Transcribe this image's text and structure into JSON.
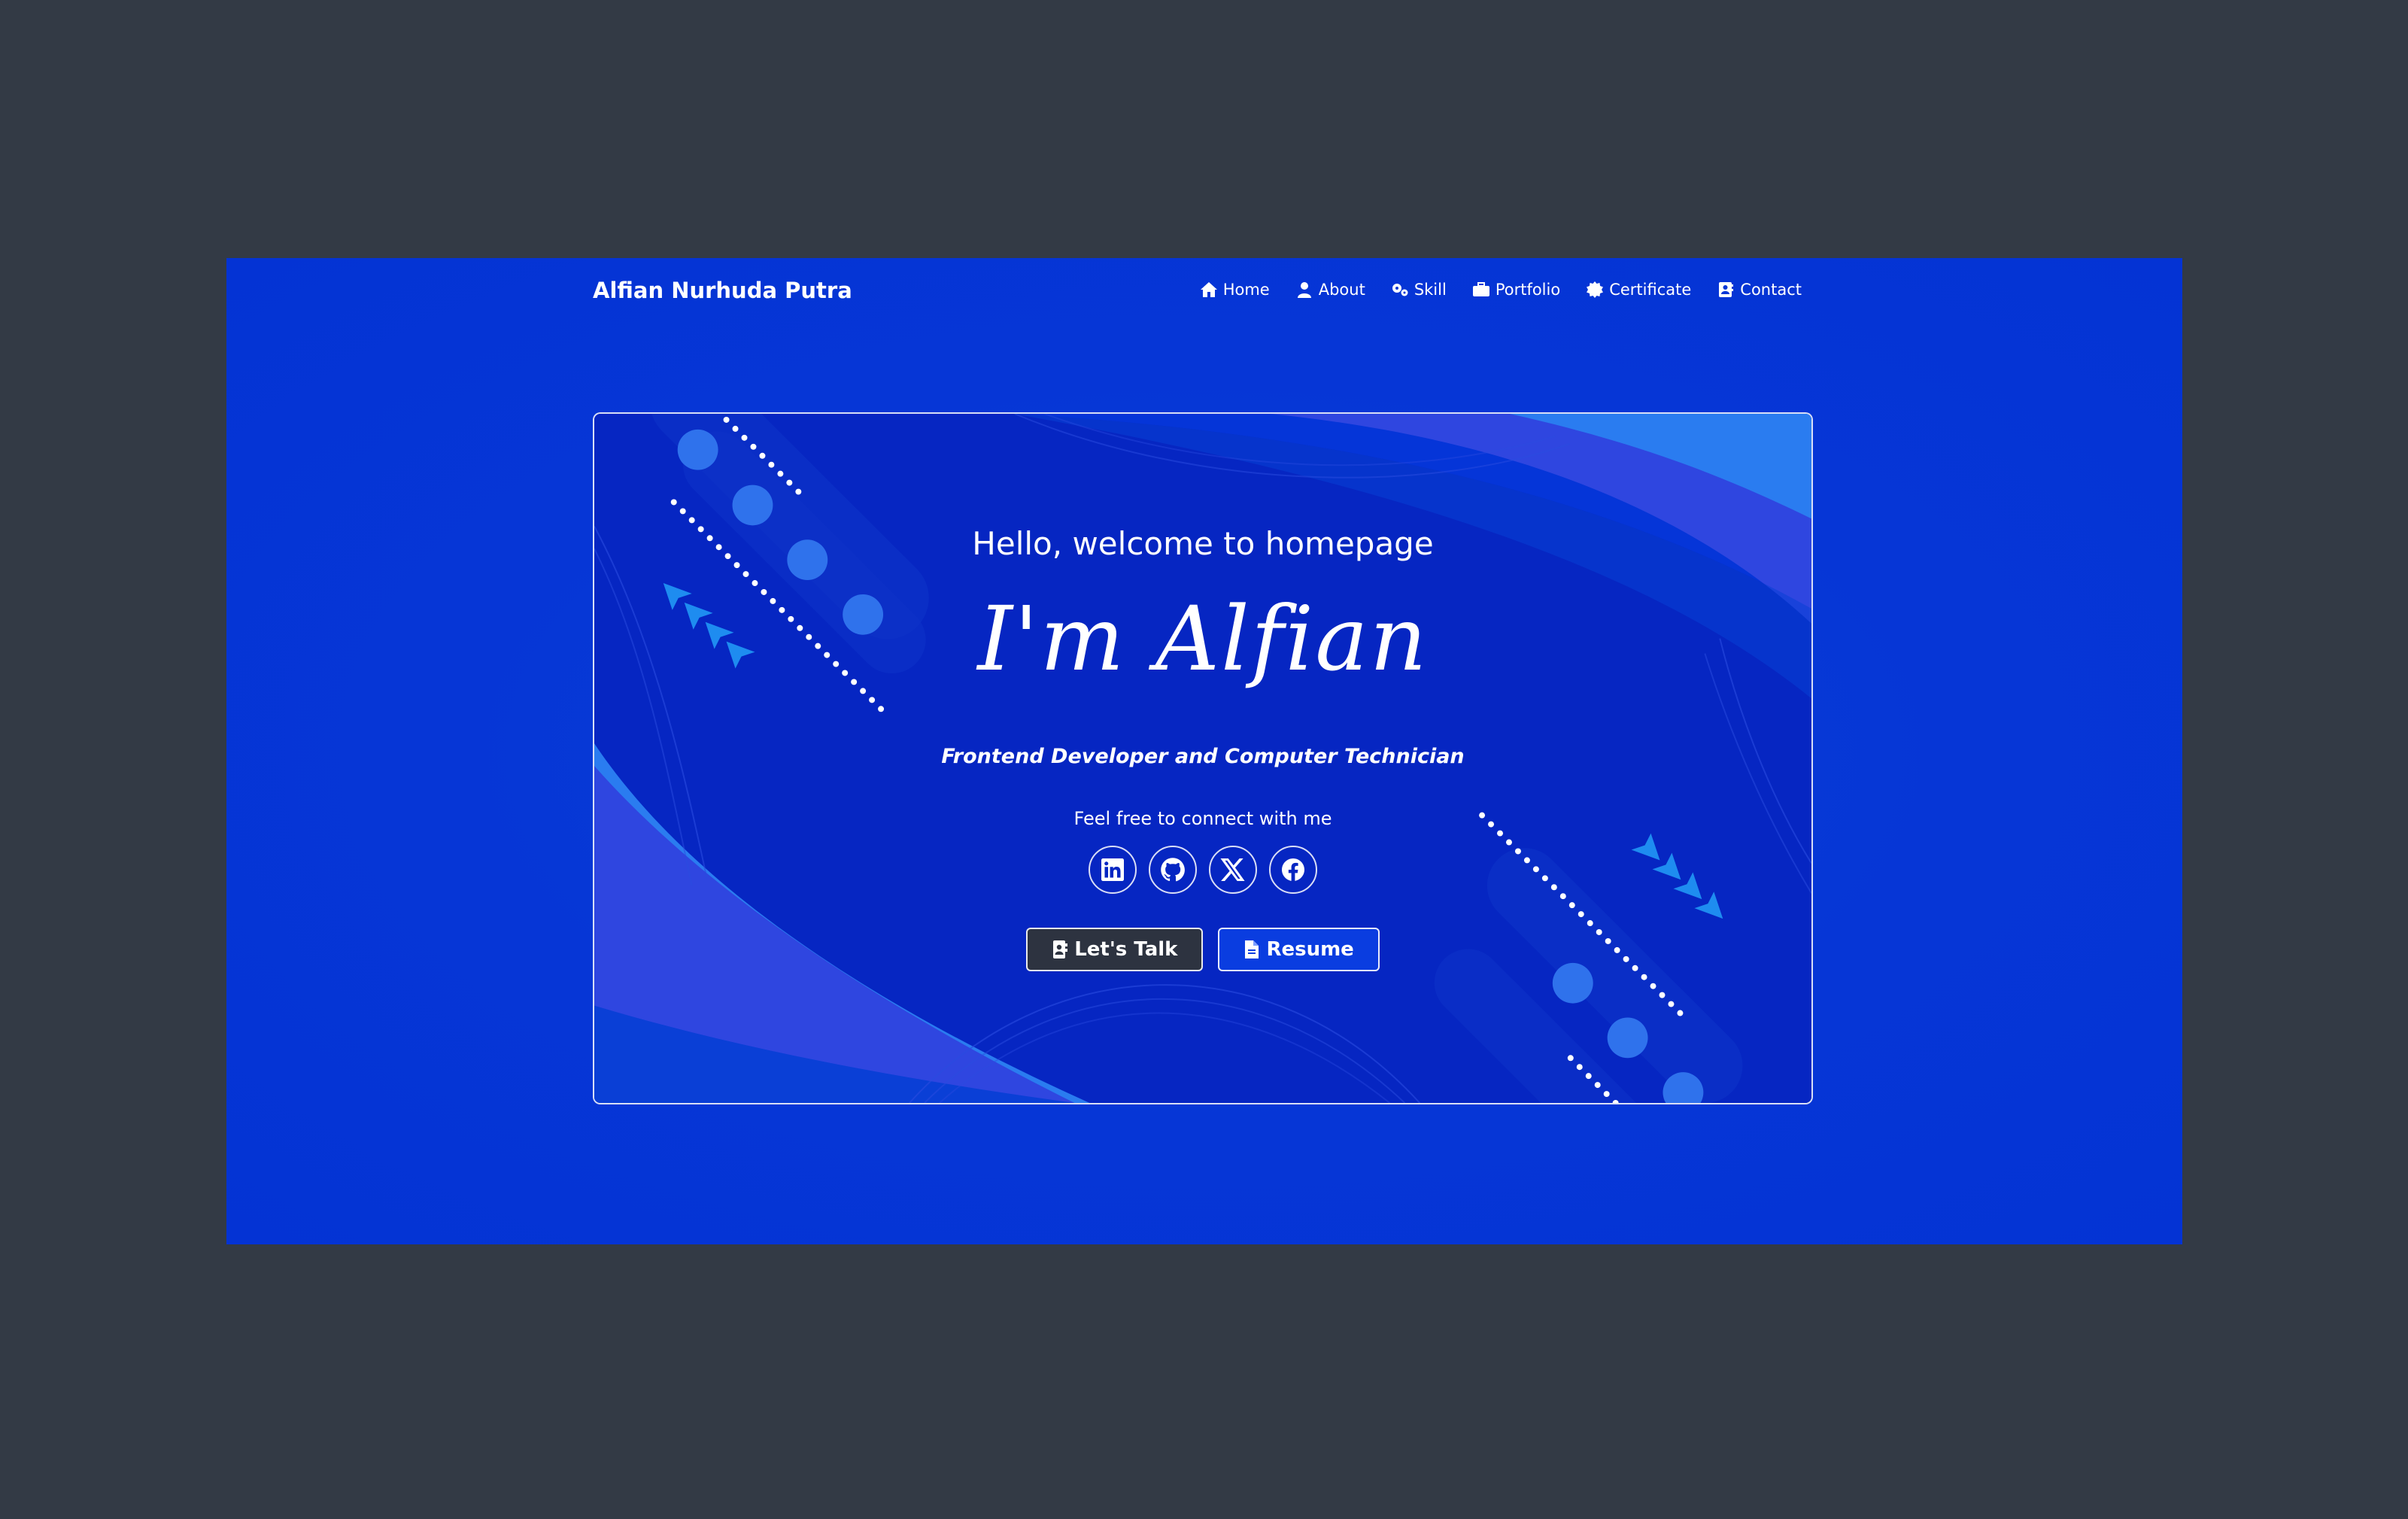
{
  "brand": "Alfian Nurhuda Putra",
  "nav": [
    {
      "label": "Home",
      "icon": "home-icon"
    },
    {
      "label": "About",
      "icon": "user-icon"
    },
    {
      "label": "Skill",
      "icon": "gears-icon"
    },
    {
      "label": "Portfolio",
      "icon": "briefcase-icon"
    },
    {
      "label": "Certificate",
      "icon": "certificate-icon"
    },
    {
      "label": "Contact",
      "icon": "address-book-icon"
    }
  ],
  "hero": {
    "greeting": "Hello, welcome to homepage",
    "title": "I'm Alfian",
    "subtitle": "Frontend Developer and Computer Technician",
    "connect": "Feel free to connect with me",
    "socials": [
      "linkedin-icon",
      "github-icon",
      "x-twitter-icon",
      "facebook-icon"
    ],
    "btn_talk": "Let's Talk",
    "btn_resume": "Resume"
  },
  "colors": {
    "page_bg": "#333a45",
    "site_bg": "#0636d6",
    "hero_bg": "#0628c4",
    "accent": "#2f46e0",
    "dark_button": "#2d3340"
  }
}
